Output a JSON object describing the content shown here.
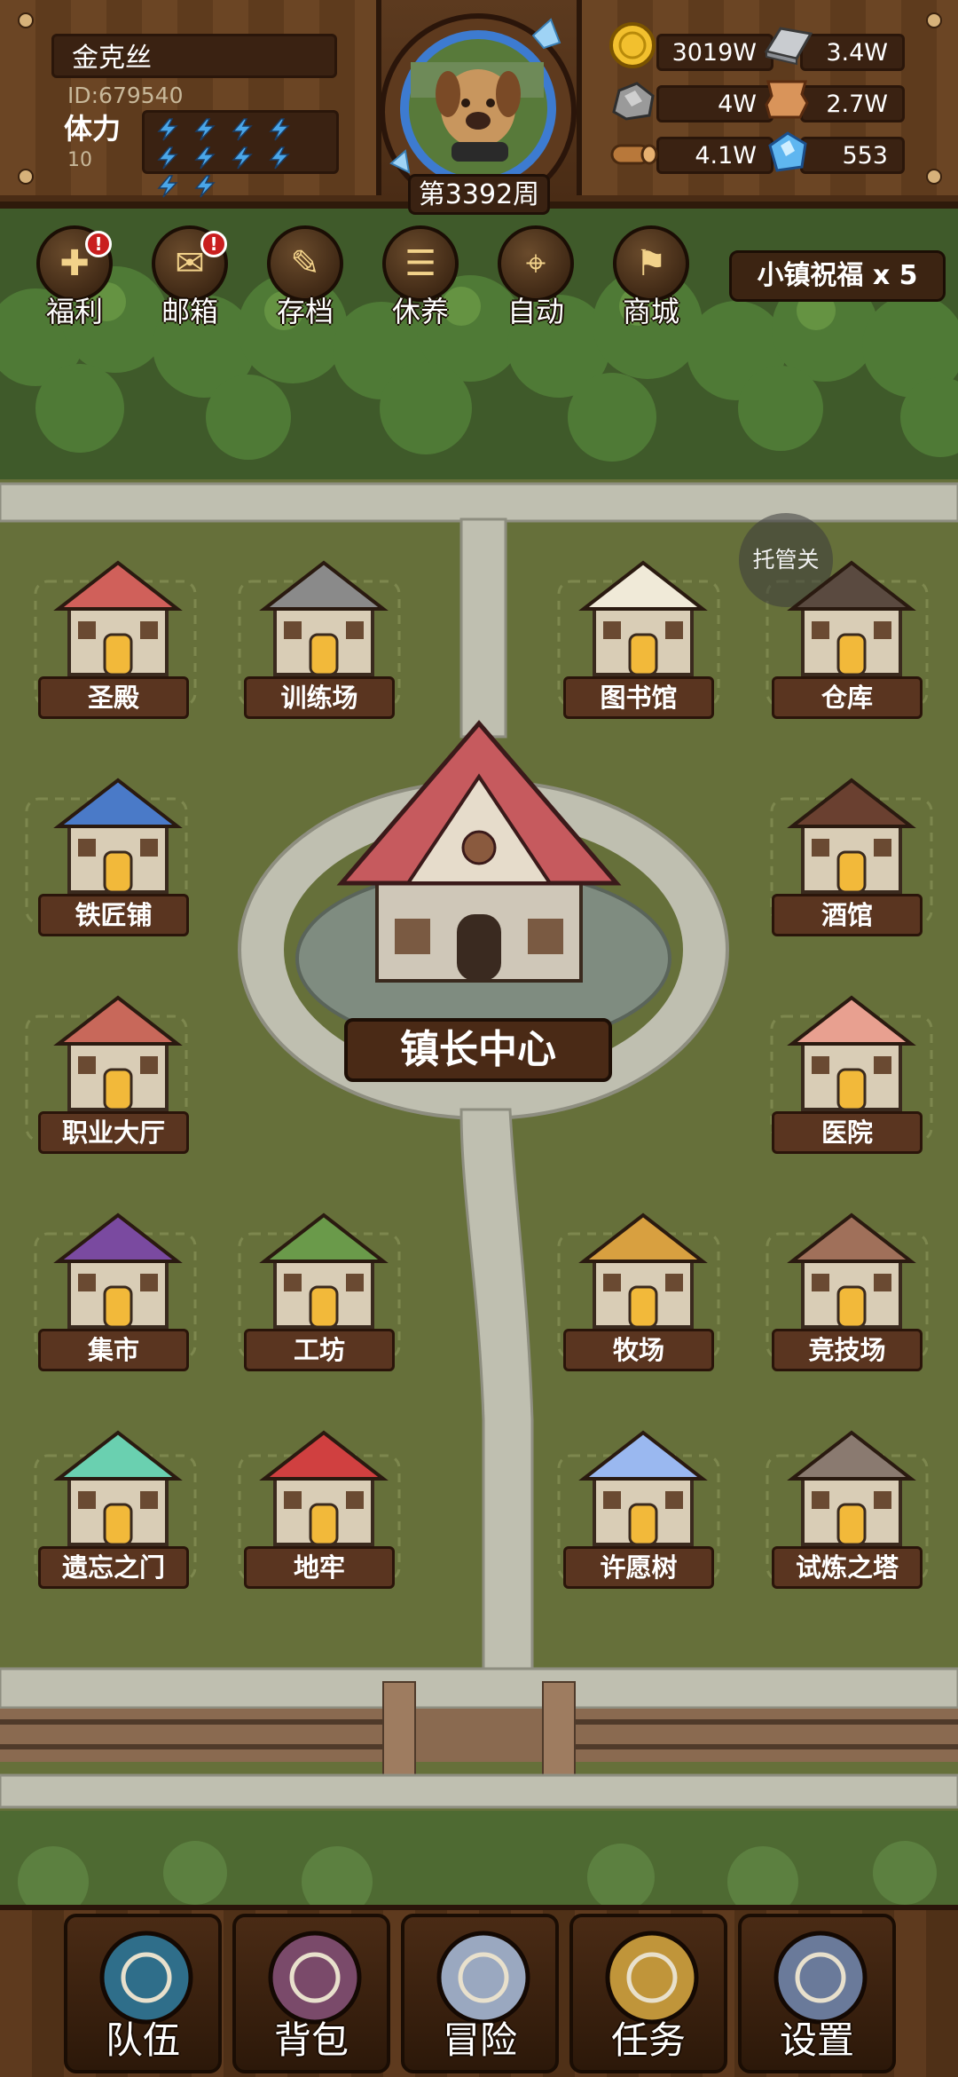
{
  "player": {
    "name": "金克丝",
    "id_text": "ID:679540",
    "stamina_label": "体力",
    "stamina_value": "10",
    "stamina_bolts": 10,
    "week_text": "第3392周"
  },
  "resources": [
    {
      "icon": "gold-coin-icon",
      "value": "3019W"
    },
    {
      "icon": "iron-ingot-icon",
      "value": "3.4W"
    },
    {
      "icon": "stone-ore-icon",
      "value": "4W"
    },
    {
      "icon": "leather-hide-icon",
      "value": "2.7W"
    },
    {
      "icon": "wood-log-icon",
      "value": "4.1W"
    },
    {
      "icon": "blue-crystal-icon",
      "value": "553"
    }
  ],
  "top_buttons": [
    {
      "label": "福利",
      "icon": "welfare-shield-icon",
      "badge": "!"
    },
    {
      "label": "邮箱",
      "icon": "mail-letter-icon",
      "badge": "!"
    },
    {
      "label": "存档",
      "icon": "save-scroll-icon",
      "badge": ""
    },
    {
      "label": "休养",
      "icon": "rest-scroll-icon",
      "badge": ""
    },
    {
      "label": "自动",
      "icon": "auto-map-icon",
      "badge": ""
    },
    {
      "label": "商城",
      "icon": "shop-bag-icon",
      "badge": ""
    }
  ],
  "blessing": "小镇祝福 x 5",
  "auto_toggle": "托管关",
  "mayor_center": "镇长中心",
  "buildings": [
    {
      "label": "圣殿",
      "icon": "temple-icon"
    },
    {
      "label": "训练场",
      "icon": "training-ground-icon"
    },
    {
      "label": "图书馆",
      "icon": "library-icon"
    },
    {
      "label": "仓库",
      "icon": "warehouse-icon"
    },
    {
      "label": "铁匠铺",
      "icon": "blacksmith-icon"
    },
    {
      "label": "酒馆",
      "icon": "tavern-icon"
    },
    {
      "label": "职业大厅",
      "icon": "class-hall-icon"
    },
    {
      "label": "医院",
      "icon": "hospital-icon"
    },
    {
      "label": "集市",
      "icon": "market-icon"
    },
    {
      "label": "工坊",
      "icon": "workshop-icon"
    },
    {
      "label": "牧场",
      "icon": "ranch-icon"
    },
    {
      "label": "竞技场",
      "icon": "arena-icon"
    },
    {
      "label": "遗忘之门",
      "icon": "portal-icon"
    },
    {
      "label": "地牢",
      "icon": "dungeon-icon"
    },
    {
      "label": "许愿树",
      "icon": "wishing-tree-icon"
    },
    {
      "label": "试炼之塔",
      "icon": "trial-tower-icon"
    }
  ],
  "bottom_nav": [
    {
      "label": "队伍",
      "icon": "helmet-icon"
    },
    {
      "label": "背包",
      "icon": "backpack-icon"
    },
    {
      "label": "冒险",
      "icon": "crossed-swords-icon"
    },
    {
      "label": "任务",
      "icon": "quest-scroll-icon"
    },
    {
      "label": "设置",
      "icon": "gear-icon"
    }
  ],
  "colors": {
    "grass": "#66703a",
    "path": "#bfbfb0",
    "wood": "#5e3a1e",
    "plate": "#5a3520",
    "badge": "#c91f1f",
    "bolt": "#4aa6e8"
  }
}
